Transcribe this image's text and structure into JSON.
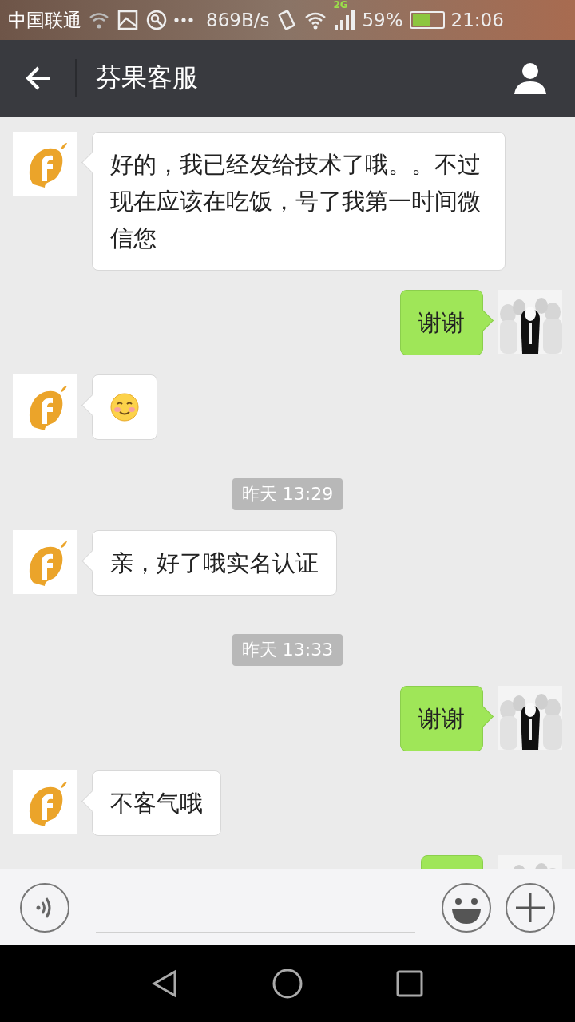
{
  "status_bar": {
    "carrier": "中国联通",
    "speed": "869B/s",
    "network": "2G",
    "battery": "59%",
    "time": "21:06"
  },
  "header": {
    "title": "芬果客服"
  },
  "messages": [
    {
      "kind": "incoming",
      "text": "好的，我已经发给技术了哦。。不过现在应该在吃饭，号了我第一时间微信您"
    },
    {
      "kind": "outgoing",
      "text": "谢谢"
    },
    {
      "kind": "emoji"
    },
    {
      "kind": "time",
      "text": "昨天 13:29"
    },
    {
      "kind": "incoming",
      "text": "亲，好了哦实名认证"
    },
    {
      "kind": "time",
      "text": "昨天 13:33"
    },
    {
      "kind": "outgoing",
      "text": "谢谢"
    },
    {
      "kind": "incoming",
      "text": "不客气哦"
    },
    {
      "kind": "outgoing_clipped"
    }
  ]
}
